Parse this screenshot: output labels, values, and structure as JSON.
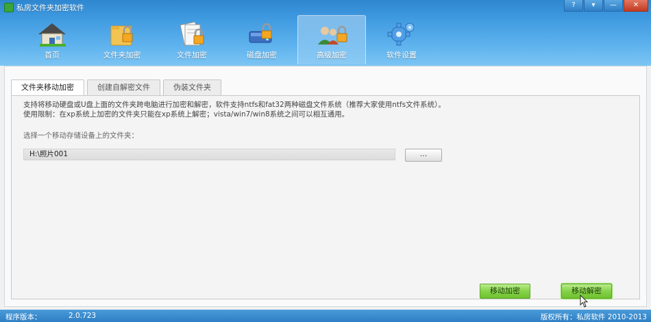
{
  "window": {
    "title": "私房文件夹加密软件",
    "controls": [
      "?",
      "▾",
      "—",
      "✕"
    ]
  },
  "toolbar": {
    "items": [
      {
        "label": "首页",
        "icon": "home-icon"
      },
      {
        "label": "文件夹加密",
        "icon": "folder-lock-icon"
      },
      {
        "label": "文件加密",
        "icon": "file-lock-icon"
      },
      {
        "label": "磁盘加密",
        "icon": "disk-lock-icon"
      },
      {
        "label": "高级加密",
        "icon": "users-lock-icon",
        "active": true
      },
      {
        "label": "软件设置",
        "icon": "gear-icon"
      }
    ]
  },
  "tabs": [
    {
      "label": "文件夹移动加密",
      "active": true
    },
    {
      "label": "创建自解密文件"
    },
    {
      "label": "伪装文件夹"
    }
  ],
  "content": {
    "description_line1": "支持将移动硬盘或U盘上面的文件夹跨电脑进行加密和解密，软件支持ntfs和fat32两种磁盘文件系统（推荐大家使用ntfs文件系统）。",
    "description_line2": "使用限制：在xp系统上加密的文件夹只能在xp系统上解密；vista/win7/win8系统之间可以相互通用。",
    "choose_label": "选择一个移动存储设备上的文件夹：",
    "path_value": "H:\\照片001",
    "browse_label": "...",
    "encrypt_button": "移动加密",
    "decrypt_button": "移动解密"
  },
  "status": {
    "version_label": "程序版本：",
    "version_value": "2.0.723",
    "copyright": "版权所有：私房软件 2010-2013"
  },
  "colors": {
    "titlebar": "#3f9ae0",
    "button_green": "#86d24a",
    "statusbar": "#2e7fc3"
  }
}
